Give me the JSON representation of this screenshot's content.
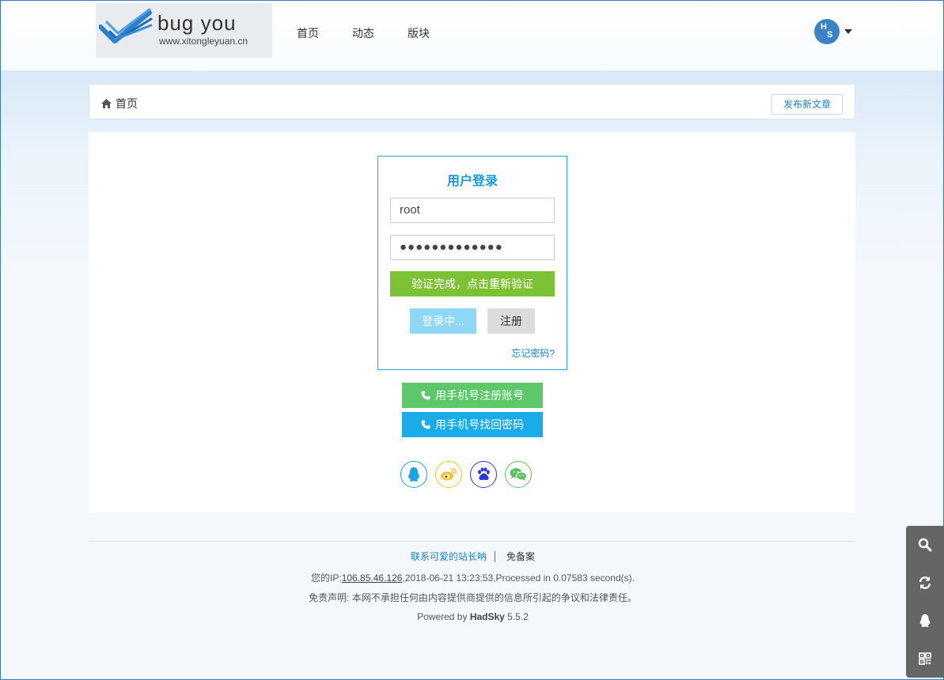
{
  "header": {
    "logo_title": "bug you",
    "logo_url": "www.xitongleyuan.cn",
    "nav": [
      "首页",
      "动态",
      "版块"
    ],
    "avatar_h": "H",
    "avatar_s": "S"
  },
  "breadcrumb": {
    "home": "首页",
    "new_post": "发布新文章"
  },
  "login": {
    "title": "用户登录",
    "username": "root",
    "password": "●●●●●●●●●●●●●",
    "verify": "验证完成，点击重新验证",
    "login_btn": "登录中...",
    "register_btn": "注册",
    "forgot": "忘记密码?"
  },
  "phone": {
    "register": "用手机号注册账号",
    "recover": "用手机号找回密码"
  },
  "socials": [
    "qq-icon",
    "weibo-icon",
    "baidu-icon",
    "wechat-icon"
  ],
  "footer": {
    "contact": "联系可爱的站长呐",
    "beian": "免备案",
    "ip_prefix": "您的IP:",
    "ip": "106.85.46.126",
    "ip_suffix": ",2018-06-21 13:23:53,Processed in 0.07583 second(s).",
    "disclaimer": "免责声明: 本网不承担任何由内容提供商提供的信息所引起的争议和法律责任。",
    "powered_prefix": "Powered by ",
    "powered_name": "HadSky",
    "powered_version": " 5.5.2"
  },
  "colors": {
    "accent": "#1a9ad6",
    "verify_green": "#7dc236",
    "phone_green": "#5cc86a",
    "phone_blue": "#1aace8"
  }
}
